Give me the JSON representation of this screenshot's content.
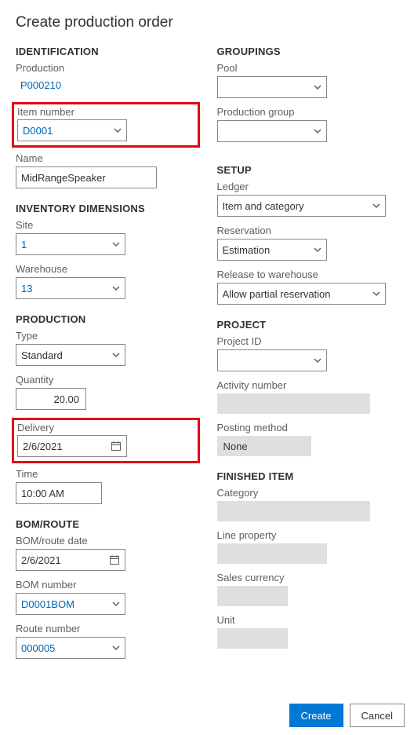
{
  "title": "Create production order",
  "left": {
    "identification": {
      "header": "IDENTIFICATION",
      "production_label": "Production",
      "production_value": "P000210",
      "item_number_label": "Item number",
      "item_number_value": "D0001",
      "name_label": "Name",
      "name_value": "MidRangeSpeaker"
    },
    "inventory": {
      "header": "INVENTORY DIMENSIONS",
      "site_label": "Site",
      "site_value": "1",
      "warehouse_label": "Warehouse",
      "warehouse_value": "13"
    },
    "production": {
      "header": "PRODUCTION",
      "type_label": "Type",
      "type_value": "Standard",
      "quantity_label": "Quantity",
      "quantity_value": "20.00",
      "delivery_label": "Delivery",
      "delivery_value": "2/6/2021",
      "time_label": "Time",
      "time_value": "10:00 AM"
    },
    "bomroute": {
      "header": "BOM/ROUTE",
      "date_label": "BOM/route date",
      "date_value": "2/6/2021",
      "bom_number_label": "BOM number",
      "bom_number_value": "D0001BOM",
      "route_number_label": "Route number",
      "route_number_value": "000005"
    }
  },
  "right": {
    "groupings": {
      "header": "GROUPINGS",
      "pool_label": "Pool",
      "pool_value": "",
      "group_label": "Production group",
      "group_value": ""
    },
    "setup": {
      "header": "SETUP",
      "ledger_label": "Ledger",
      "ledger_value": "Item and category",
      "reservation_label": "Reservation",
      "reservation_value": "Estimation",
      "release_label": "Release to warehouse",
      "release_value": "Allow partial reservation"
    },
    "project": {
      "header": "PROJECT",
      "project_id_label": "Project ID",
      "project_id_value": "",
      "activity_label": "Activity number",
      "activity_value": "",
      "posting_label": "Posting method",
      "posting_value": "None"
    },
    "finished": {
      "header": "FINISHED ITEM",
      "category_label": "Category",
      "category_value": "",
      "line_property_label": "Line property",
      "line_property_value": "",
      "sales_currency_label": "Sales currency",
      "sales_currency_value": "",
      "unit_label": "Unit",
      "unit_value": ""
    }
  },
  "footer": {
    "create": "Create",
    "cancel": "Cancel"
  }
}
